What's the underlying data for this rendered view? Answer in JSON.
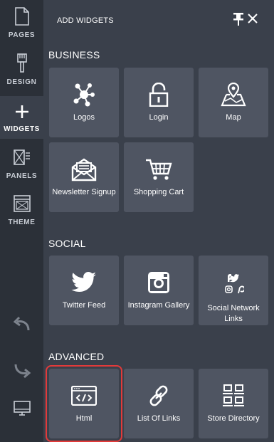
{
  "rail": {
    "items": [
      {
        "label": "PAGES",
        "icon": "page-icon"
      },
      {
        "label": "DESIGN",
        "icon": "paintbrush-icon"
      },
      {
        "label": "WIDGETS",
        "icon": "plus-icon"
      },
      {
        "label": "PANELS",
        "icon": "panels-icon"
      },
      {
        "label": "THEME",
        "icon": "theme-icon"
      }
    ],
    "bottom": [
      {
        "icon": "undo-icon"
      },
      {
        "icon": "redo-icon"
      },
      {
        "icon": "monitor-icon"
      }
    ]
  },
  "panel": {
    "title": "ADD WIDGETS",
    "sections": [
      {
        "title": "BUSINESS",
        "tiles": [
          "Logos",
          "Login",
          "Map",
          "Newsletter Signup",
          "Shopping Cart"
        ]
      },
      {
        "title": "SOCIAL",
        "tiles": [
          "Twitter Feed",
          "Instagram Gallery",
          "Social Network Links"
        ]
      },
      {
        "title": "ADVANCED",
        "tiles": [
          "Html",
          "List Of Links",
          "Store Directory"
        ]
      }
    ]
  },
  "colors": {
    "rail_bg": "#2b3038",
    "panel_bg": "#3a404b",
    "tile_bg": "#4f5562",
    "highlight": "#e23a3a"
  }
}
